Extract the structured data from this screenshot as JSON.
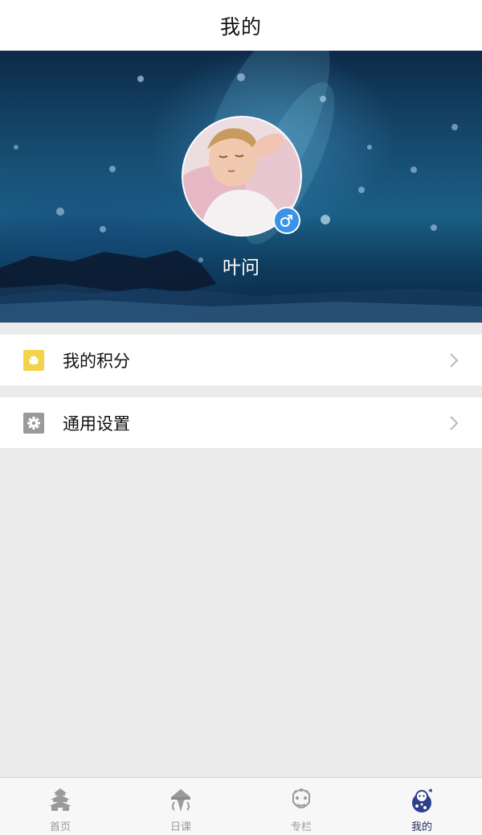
{
  "header": {
    "title": "我的"
  },
  "profile": {
    "username": "叶问",
    "gender_icon": "male-icon",
    "accent_color": "#3a93e6"
  },
  "menu": {
    "items": [
      {
        "label": "我的积分",
        "icon": "points-icon",
        "icon_color": "#f3d34a"
      },
      {
        "label": "通用设置",
        "icon": "settings-icon",
        "icon_color": "#9a9a9a"
      }
    ]
  },
  "tabbar": {
    "tabs": [
      {
        "label": "首页",
        "icon": "temple-icon",
        "active": false
      },
      {
        "label": "日课",
        "icon": "kite-icon",
        "active": false
      },
      {
        "label": "专栏",
        "icon": "opera-mask-icon",
        "active": false
      },
      {
        "label": "我的",
        "icon": "character-icon",
        "active": true
      }
    ],
    "active_color": "#1f2a5a",
    "inactive_color": "#9a9a9a"
  }
}
